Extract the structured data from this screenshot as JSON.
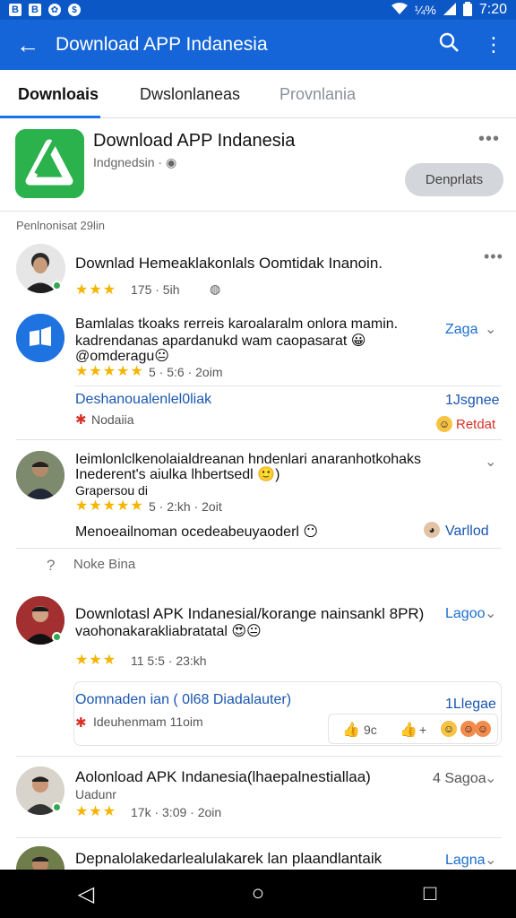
{
  "status_bar": {
    "left_icons": [
      "B",
      "B",
      "✿",
      "$"
    ],
    "battery_text": "¼%",
    "time": "7:20"
  },
  "app_bar": {
    "title": "Download APP Indanesia",
    "back_icon": "←",
    "search_icon": "⌕",
    "more_icon": "⋮"
  },
  "tabs": [
    {
      "label": "Downloais"
    },
    {
      "label": "Dwslonlaneas"
    },
    {
      "label": "Provnlania"
    }
  ],
  "app_card": {
    "name": "Download APP Indanesia",
    "developer": "Indgnedsin ·",
    "action_label": "Denprlats",
    "more": "•••"
  },
  "section_label": "Penlnonisat 29lin",
  "reviews": [
    {
      "title": "Downlad Hemeaklakonlals Oomtidak Inanoin.",
      "stars": "★★★",
      "meta": "175 · 5ih",
      "meta_icon": "◍",
      "more": "•••"
    },
    {
      "body": [
        "Bamlalas tkoaks rerreis karoalaralm onlora mamin.",
        "kadrendanas apardanukd wam caopasarat 😀",
        "@omderagu😐"
      ],
      "stars": "★★★★★",
      "meta": "5 · 5:6 · 2oim",
      "tag": "Zaga",
      "link": "Deshanoualenlel0liak",
      "link_right": "1Jsgnee",
      "sub": "Nodaiia",
      "sub_right": "Retdat"
    },
    {
      "body": [
        "Ieimlonlclkenolaialdreanan hndenlari anaranhotkohaks",
        "Inederent's aiulka lhbertsedl 🙂)",
        "Grapersou di"
      ],
      "stars": "★★★★★",
      "meta": "5 · 2:kh · 2oit",
      "caption": "Menoeailnoman ocedeabeuyaoderl 😶",
      "caption_right": "Varllod"
    },
    {
      "note": "Noke Bina"
    },
    {
      "title": "Downlotasl APK Indanesial/korange nainsankl 8PR)",
      "body": [
        "vaohonakarakliabratatal 😍😐"
      ],
      "stars": "★★★",
      "meta": "11 5:5 · 23:kh",
      "tag": "Lagoo",
      "link": "Oomnaden ian ( 0l68 Diadalauter)",
      "link_right": "1Llegae",
      "sub": "Ideuhenmam 11oim",
      "reply_count": "9c",
      "reply_plus": "+"
    },
    {
      "title": "Aolonload APK Indanesia(lhaepalnestiallaa)",
      "subtitle": "Uadunr",
      "stars": "★★★",
      "meta": "17k · 3:09 · 2oin",
      "tag": "4 Sagoa"
    },
    {
      "title": "Depnalolakedarlealulakarek lan plaandlantaik",
      "tag": "Lagna"
    }
  ],
  "nav_bar": {
    "back": "◁",
    "home": "○",
    "recents": "□"
  }
}
